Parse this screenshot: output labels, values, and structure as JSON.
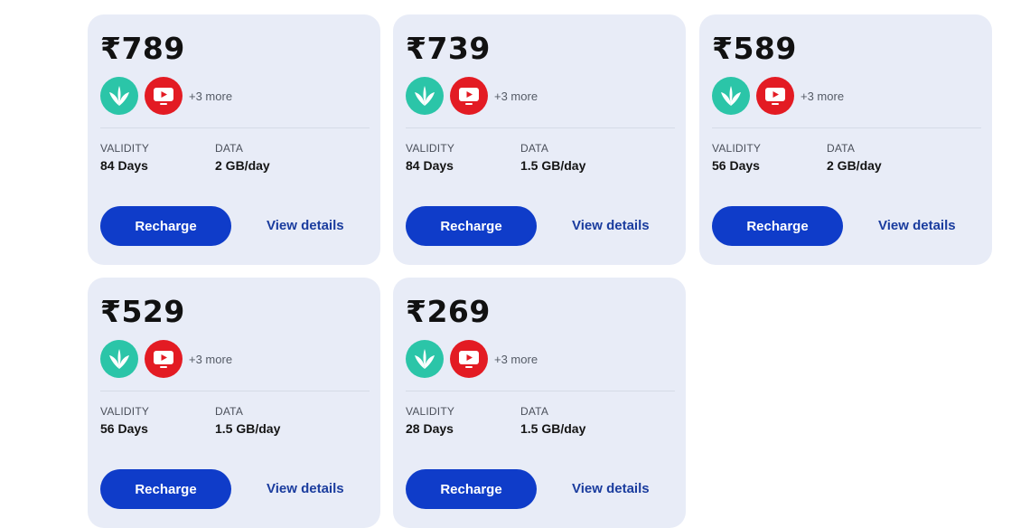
{
  "plans": [
    {
      "price": "₹789",
      "more": "+3 more",
      "validity_label": "VALIDITY",
      "validity": "84 Days",
      "data_label": "DATA",
      "data": "2 GB/day",
      "recharge": "Recharge",
      "details": "View details"
    },
    {
      "price": "₹739",
      "more": "+3 more",
      "validity_label": "VALIDITY",
      "validity": "84 Days",
      "data_label": "DATA",
      "data": "1.5 GB/day",
      "recharge": "Recharge",
      "details": "View details"
    },
    {
      "price": "₹589",
      "more": "+3 more",
      "validity_label": "VALIDITY",
      "validity": "56 Days",
      "data_label": "DATA",
      "data": "2 GB/day",
      "recharge": "Recharge",
      "details": "View details"
    },
    {
      "price": "₹529",
      "more": "+3 more",
      "validity_label": "VALIDITY",
      "validity": "56 Days",
      "data_label": "DATA",
      "data": "1.5 GB/day",
      "recharge": "Recharge",
      "details": "View details"
    },
    {
      "price": "₹269",
      "more": "+3 more",
      "validity_label": "VALIDITY",
      "validity": "28 Days",
      "data_label": "DATA",
      "data": "1.5 GB/day",
      "recharge": "Recharge",
      "details": "View details"
    }
  ],
  "icons": {
    "app1": "jiosaavn-icon",
    "app2": "jiotv-icon"
  },
  "colors": {
    "card_bg": "#e8ecf7",
    "button": "#0f3cc9",
    "link": "#1a3c9e",
    "saavn": "#2bc5a8",
    "tv": "#e31b23"
  }
}
